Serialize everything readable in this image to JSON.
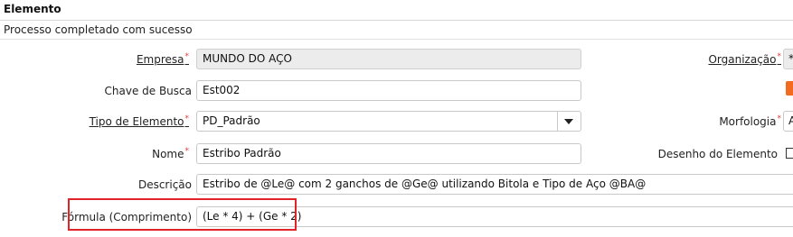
{
  "header": {
    "title": "Elemento"
  },
  "message": "Processo completado com sucesso",
  "form": {
    "empresa": {
      "label": "Empresa",
      "value": "MUNDO DO AÇO"
    },
    "chave": {
      "label": "Chave de Busca",
      "value": "Est002"
    },
    "tipo": {
      "label": "Tipo de Elemento",
      "value": "PD_Padrão"
    },
    "nome": {
      "label": "Nome",
      "value": "Estribo Padrão"
    },
    "descricao": {
      "label": "Descrição",
      "value": "Estribo de @Le@ com 2 ganchos de @Ge@ utilizando Bitola e Tipo de Aço @BA@"
    },
    "formula": {
      "label": "Fórmula (Comprimento)",
      "value": "(Le * 4) + (Ge * 2)"
    },
    "organizacao": {
      "label": "Organização",
      "value": "*"
    },
    "morfologia": {
      "label": "Morfologia",
      "value": "A"
    },
    "desenho": {
      "label": "Desenho do Elemento"
    }
  },
  "colors": {
    "required": "#e53935",
    "highlight": "#e0242a",
    "accent": "#f26b21"
  }
}
